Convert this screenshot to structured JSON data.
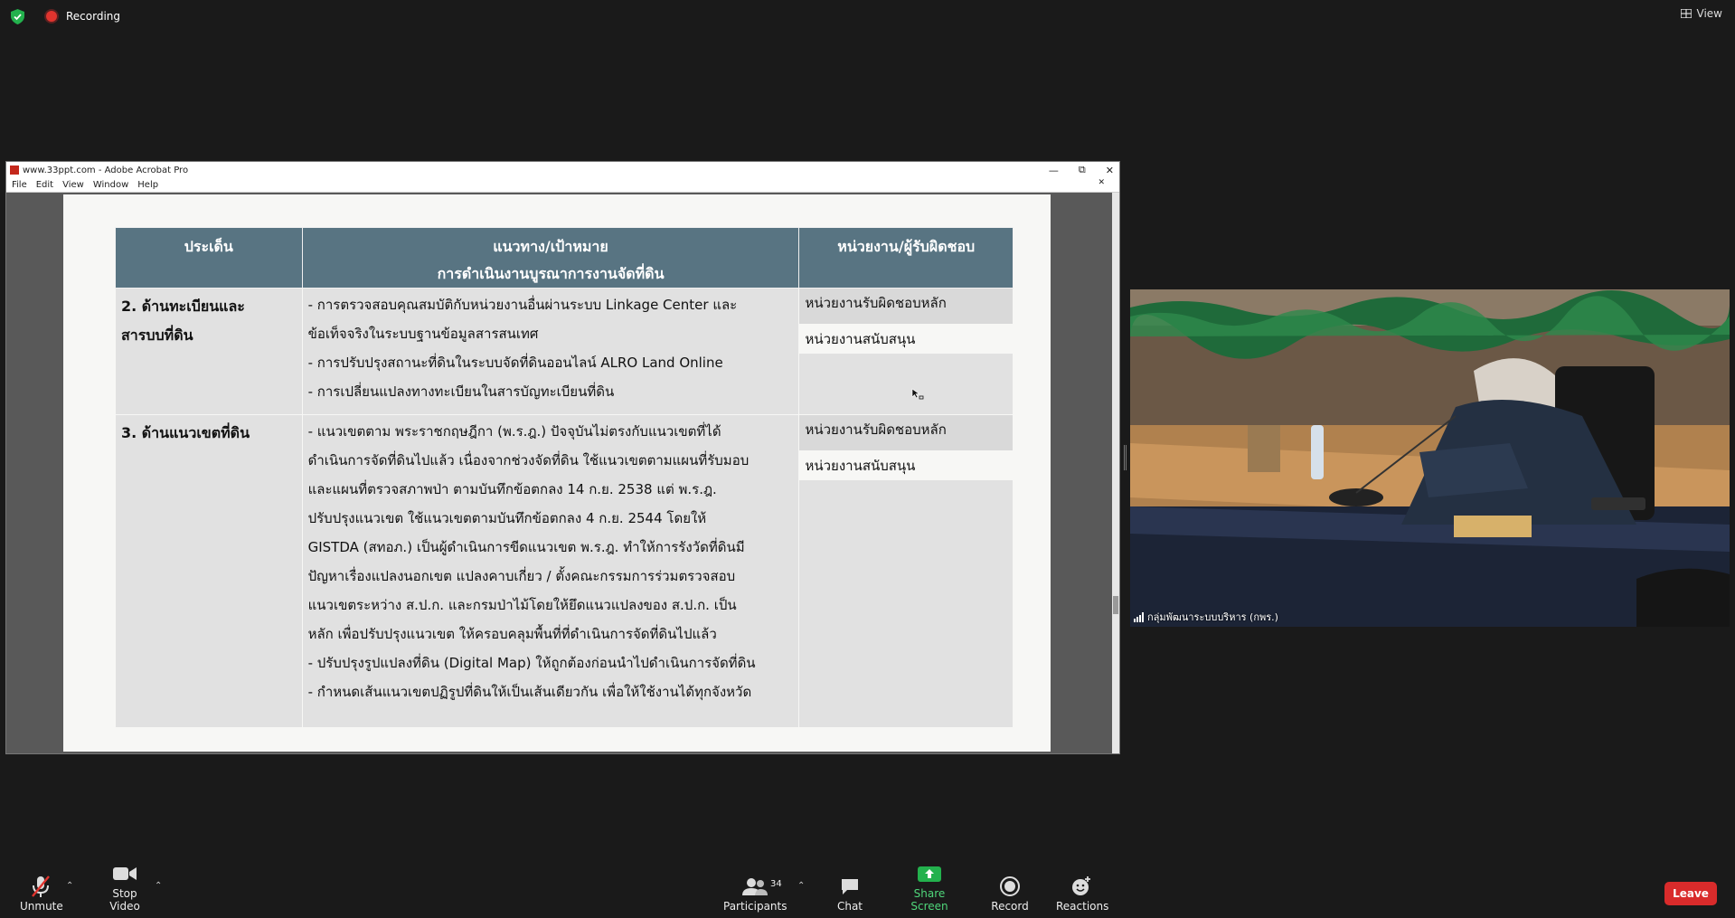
{
  "status": {
    "recording_label": "Recording"
  },
  "view_label": "View",
  "acrobat": {
    "title": "www.33ppt.com - Adobe Acrobat Pro",
    "menu": [
      "File",
      "Edit",
      "View",
      "Window",
      "Help"
    ]
  },
  "slide": {
    "headers": {
      "col1": "ประเด็น",
      "col2_line1": "แนวทาง/เป้าหมาย",
      "col2_line2": "การดำเนินงานบูรณาการงานจัดที่ดิน",
      "col3": "หน่วยงาน/ผู้รับผิดชอบ"
    },
    "rows": [
      {
        "topic_line1": "2. ด้านทะเบียนและ",
        "topic_line2": "สารบบที่ดิน",
        "lines": [
          "- การตรวจสอบคุณสมบัติกับหน่วยงานอื่นผ่านระบบ Linkage Center และ",
          "ข้อเท็จจริงในระบบฐานข้อมูลสารสนเทศ",
          "- การปรับปรุงสถานะที่ดินในระบบจัดที่ดินออนไลน์ ALRO Land Online",
          "- การเปลี่ยนแปลงทางทะเบียนในสารบัญทะเบียนที่ดิน"
        ],
        "main_unit": "หน่วยงานรับผิดชอบหลัก",
        "support_unit": "หน่วยงานสนับสนุน"
      },
      {
        "topic_line1": "3. ด้านแนวเขตที่ดิน",
        "lines": [
          "- แนวเขตตาม พระราชกฤษฎีกา (พ.ร.ฎ.) ปัจจุบันไม่ตรงกับแนวเขตที่ได้",
          "ดำเนินการจัดที่ดินไปแล้ว เนื่องจากช่วงจัดที่ดิน ใช้แนวเขตตามแผนที่รับมอบ",
          "และแผนที่ตรวจสภาพป่า ตามบันทึกข้อตกลง 14 ก.ย. 2538 แต่ พ.ร.ฎ.",
          "ปรับปรุงแนวเขต ใช้แนวเขตตามบันทึกข้อตกลง 4 ก.ย. 2544 โดยให้",
          "GISTDA (สทอภ.) เป็นผู้ดำเนินการขีดแนวเขต พ.ร.ฎ. ทำให้การรังวัดที่ดินมี",
          "ปัญหาเรื่องแปลงนอกเขต แปลงคาบเกี่ยว / ตั้งคณะกรรมการร่วมตรวจสอบ",
          "แนวเขตระหว่าง ส.ป.ก. และกรมป่าไม้โดยให้ยึดแนวแปลงของ ส.ป.ก. เป็น",
          "หลัก เพื่อปรับปรุงแนวเขต ให้ครอบคลุมพื้นที่ที่ดำเนินการจัดที่ดินไปแล้ว",
          "- ปรับปรุงรูปแปลงที่ดิน (Digital Map) ให้ถูกต้องก่อนนำไปดำเนินการจัดที่ดิน",
          "- กำหนดเส้นแนวเขตปฏิรูปที่ดินให้เป็นเส้นเดียวกัน เพื่อให้ใช้งานได้ทุกจังหวัด"
        ],
        "main_unit": "หน่วยงานรับผิดชอบหลัก",
        "support_unit": "หน่วยงานสนับสนุน"
      }
    ]
  },
  "camera": {
    "participant_name": "กลุ่มพัฒนาระบบบริหาร (กพร.)"
  },
  "toolbar": {
    "unmute": "Unmute",
    "stop_video": "Stop Video",
    "participants": "Participants",
    "participants_count": "34",
    "chat": "Chat",
    "share_screen": "Share Screen",
    "record": "Record",
    "reactions": "Reactions",
    "leave": "Leave"
  },
  "colors": {
    "table_header": "#587482",
    "share_green": "#23b14d",
    "leave_red": "#d92b2b",
    "recording_red": "#e0342e"
  }
}
